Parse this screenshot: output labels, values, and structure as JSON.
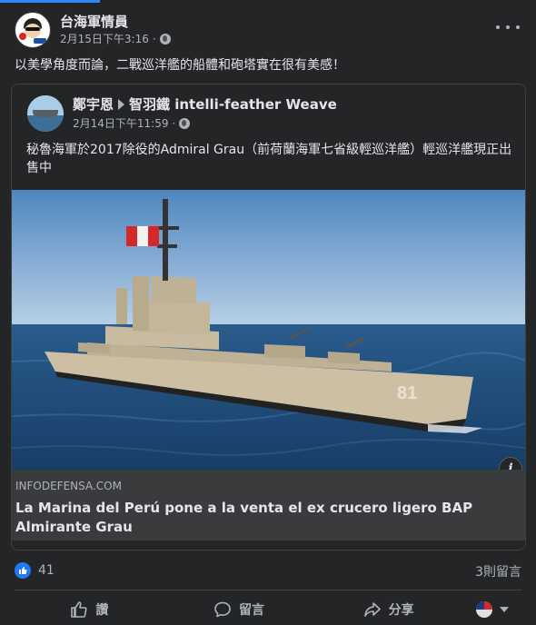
{
  "post": {
    "page_name": "台海軍情員",
    "timestamp": "2月15日下午3:16",
    "dot": "·",
    "text": "以美學角度而論，二戰巡洋艦的船體和砲塔實在很有美感！"
  },
  "shared_post": {
    "author": "鄭宇恩",
    "group": "智羽鐵 intelli-feather Weave",
    "timestamp": "2月14日下午11:59",
    "dot": "·",
    "text": "秘魯海軍於2017除役的Admiral Grau（前荷蘭海軍七省級輕巡洋艦）輕巡洋艦現正出售中"
  },
  "link": {
    "domain": "INFODEFENSA.COM",
    "title": "La Marina del Perú pone a la venta el ex crucero ligero BAP Almirante Grau",
    "hull_number": "81",
    "info_label": "i"
  },
  "engagement": {
    "like_count": "41",
    "comment_count": "3則留言"
  },
  "actions": {
    "like": "讚",
    "comment": "留言",
    "share": "分享"
  },
  "colors": {
    "accent": "#2d88ff",
    "like_blue": "#2078f4",
    "card_bg": "#242526",
    "link_bg": "#3a3b3c"
  }
}
